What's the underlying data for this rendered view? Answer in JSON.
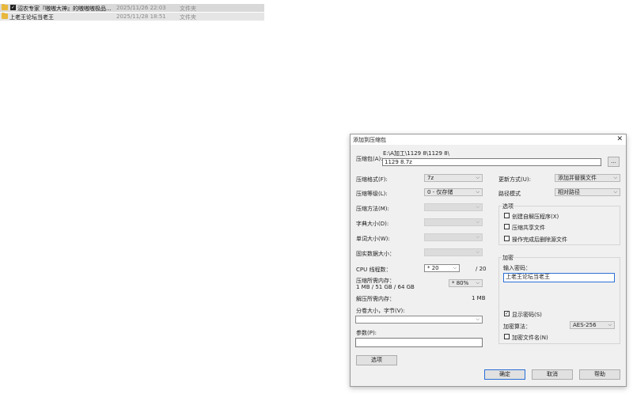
{
  "files": [
    {
      "name": "沼农专家『嗷嗷大神』的嗷嗷嗷极品...",
      "date": "2025/11/26 22:03",
      "type": "文件夹",
      "checked": true
    },
    {
      "name": "上老王论坛当老王",
      "date": "2025/11/28 18:51",
      "type": "文件夹",
      "checked": false
    }
  ],
  "dialog": {
    "title": "添加到压缩包",
    "close_glyph": "✕",
    "archive_label": "压缩包(A):",
    "archive_path": "E:\\A加工\\1129 8\\1129 8\\",
    "archive_name": "1129 8.7z",
    "browse_label": "...",
    "format_label": "压缩格式(F):",
    "format_value": "7z",
    "level_label": "压缩等级(L):",
    "level_value": "0 - 仅存储",
    "method_label": "压缩方法(M):",
    "dict_label": "字典大小(D):",
    "word_label": "单词大小(W):",
    "solid_label": "固实数据大小：",
    "cpu_label": "CPU 线程数：",
    "cpu_value": "* 20",
    "cpu_total": "/ 20",
    "mem_comp_label": "压缩所需内存：",
    "mem_comp_detail": "1 MB / 51 GB / 64 GB",
    "mem_comp_value": "* 80%",
    "mem_decomp_label": "解压所需内存：",
    "mem_decomp_value": "1 MB",
    "split_label": "分卷大小，字节(V):",
    "params_label": "参数(P):",
    "options_button": "选项",
    "update_label": "更新方式(U):",
    "update_value": "添加并替换文件",
    "path_label": "路径模式",
    "path_value": "相对路径",
    "options_group": "选项",
    "opt_sfx": "创建自解压程序(X)",
    "opt_shared": "压缩共享文件",
    "opt_delete": "操作完成后删除源文件",
    "encrypt_group": "加密",
    "password_label": "输入密码：",
    "password_value": "上老王论坛当老王",
    "show_password": "显示密码(S)",
    "enc_method_label": "加密算法：",
    "enc_method_value": "AES-256",
    "enc_filenames": "加密文件名(N)",
    "ok_button": "确定",
    "cancel_button": "取消",
    "help_button": "帮助"
  },
  "icons": {
    "folder": "folder-icon",
    "checkbox": "check-icon",
    "dropdown": "chevron-down-icon"
  },
  "colors": {
    "folder": "#e8b83c",
    "focus": "#2a6fd6",
    "dialog_bg": "#f0f0f0"
  }
}
